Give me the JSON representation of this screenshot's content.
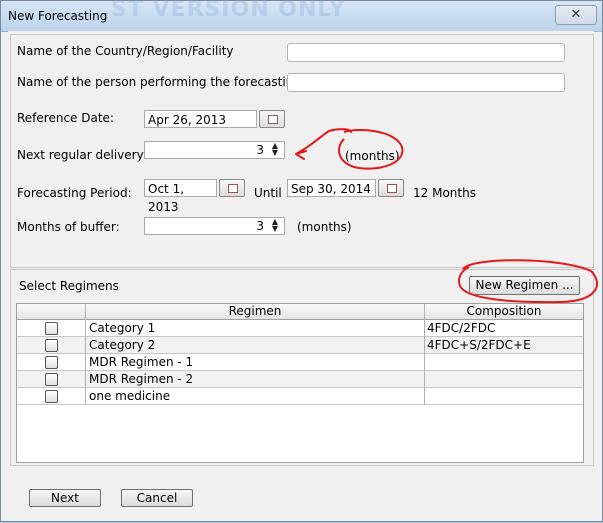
{
  "window": {
    "title": "New Forecasting",
    "watermark": "ST VERSION ONLY",
    "close_glyph": "✕"
  },
  "form": {
    "country_label": "Name of the Country/Region/Facility",
    "country_value": "",
    "person_label": "Name of the person performing the forecasting",
    "person_value": "",
    "reference_date_label": "Reference Date:",
    "reference_date_value": "Apr 26, 2013",
    "next_delivery_label": "Next regular delivery:",
    "next_delivery_value": "3",
    "next_delivery_unit": "(months)",
    "period_label": "Forecasting Period:",
    "period_start": "Oct 1, 2013",
    "period_until": "Until",
    "period_end": "Sep 30, 2014",
    "period_months": "12 Months",
    "buffer_label": "Months of buffer:",
    "buffer_value": "3",
    "buffer_unit": "(months)",
    "calendar_icon": "calendar-icon",
    "spinner_icon": "up-down-arrows-icon"
  },
  "regimens": {
    "section_label": "Select Regimens",
    "new_button": "New Regimen ...",
    "columns": {
      "check": "",
      "regimen": "Regimen",
      "composition": "Composition"
    },
    "rows": [
      {
        "regimen": "Category 1",
        "composition": "4FDC/2FDC"
      },
      {
        "regimen": "Category 2",
        "composition": "4FDC+S/2FDC+E"
      },
      {
        "regimen": "MDR Regimen - 1",
        "composition": ""
      },
      {
        "regimen": "MDR Regimen - 2",
        "composition": ""
      },
      {
        "regimen": "one medicine",
        "composition": ""
      }
    ]
  },
  "footer": {
    "next_label": "Next",
    "cancel_label": "Cancel"
  },
  "colors": {
    "annotation": "#e01b1b",
    "titlebar": "#c8dcf0"
  }
}
